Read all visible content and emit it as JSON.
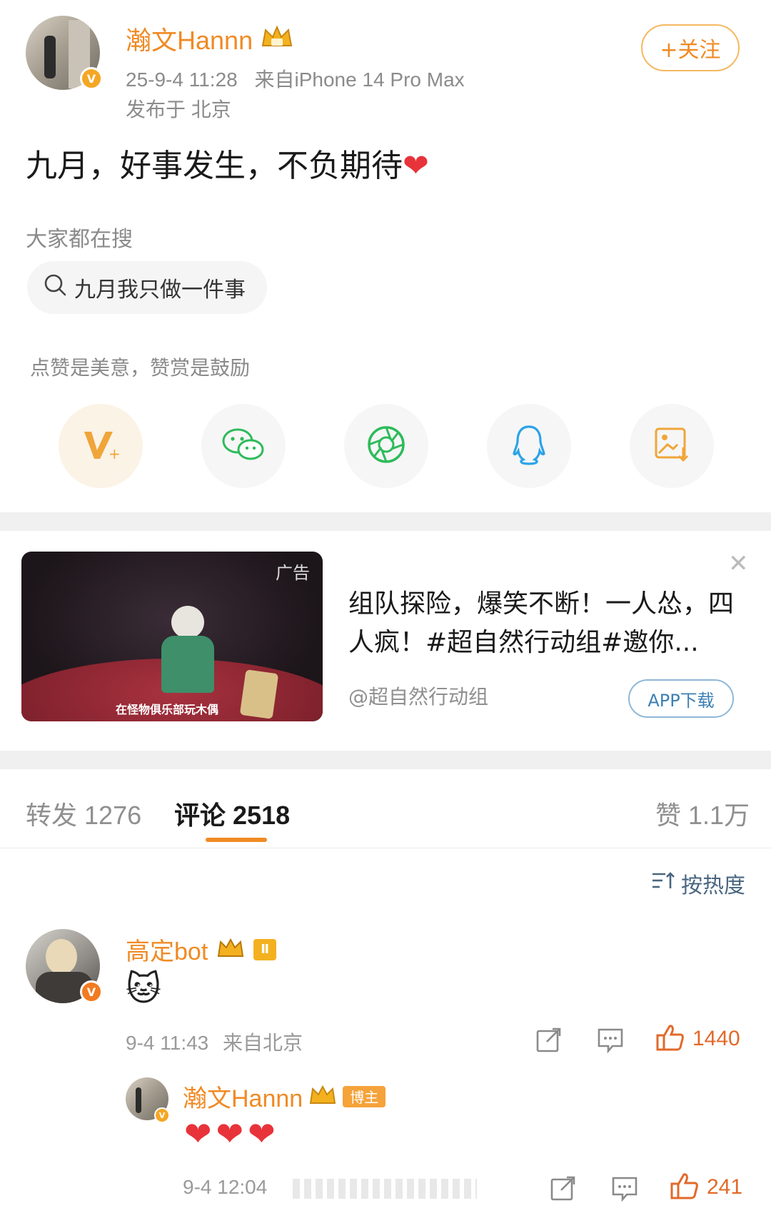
{
  "post": {
    "username": "瀚文Hannn",
    "timestamp": "25-9-4 11:28",
    "source": "来自iPhone 14 Pro Max",
    "location": "发布于 北京",
    "follow_label": "+关注",
    "text": "九月，好事发生，不负期待",
    "emoji": "❤"
  },
  "trending": {
    "label": "大家都在搜",
    "query": "九月我只做一件事"
  },
  "reward": {
    "label": "点赞是美意，赞赏是鼓励",
    "share_targets": [
      "weibo-vplus-icon",
      "wechat-icon",
      "moments-icon",
      "qq-icon",
      "save-image-icon"
    ]
  },
  "ad": {
    "tag": "广告",
    "image_caption": "在怪物俱乐部玩木偶",
    "title": "组队探险，爆笑不断！一人怂，四人疯！#超自然行动组#邀你...",
    "author": "@超自然行动组",
    "button_label": "APP下载"
  },
  "tabs": {
    "repost_label": "转发",
    "repost_count": "1276",
    "comment_label": "评论",
    "comment_count": "2518",
    "like_label": "赞",
    "like_count": "1.1万",
    "sort_label": "按热度"
  },
  "comments": [
    {
      "username": "高定bot",
      "badge": "Ⅱ",
      "emoji": "🐱",
      "time": "9-4 11:43",
      "location": "来自北京",
      "likes": "1440"
    }
  ],
  "reply": {
    "username": "瀚文Hannn",
    "badge": "博主",
    "content": "❤❤❤",
    "time": "9-4 12:04",
    "likes": "241"
  },
  "colors": {
    "accent": "#f08a24",
    "heart": "#e8333a",
    "link_blue": "#3d7fb3"
  }
}
